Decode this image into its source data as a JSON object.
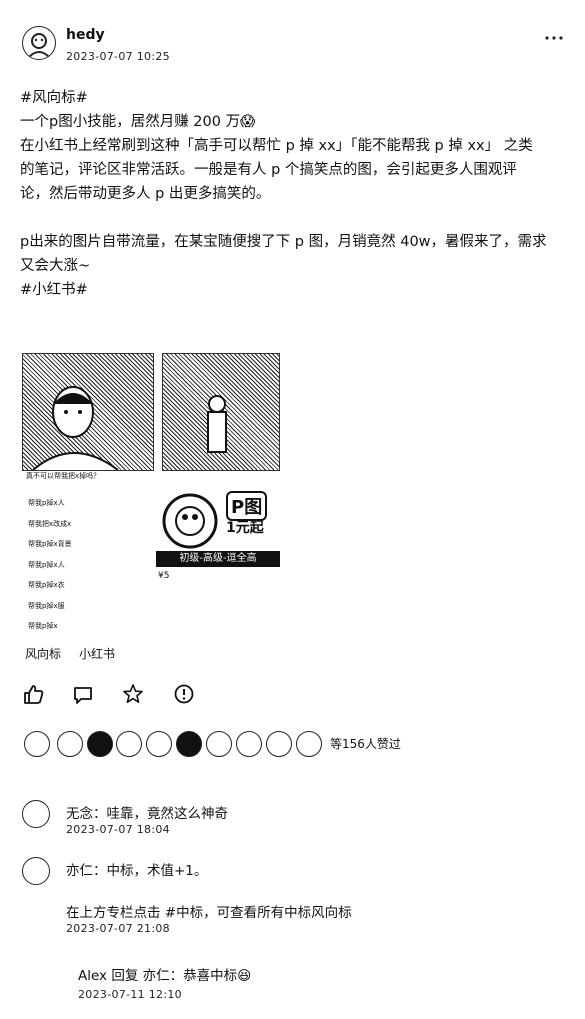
{
  "header": {
    "username": "hedy",
    "timestamp": "2023-07-07 10:25",
    "more_icon": "more-dots-icon"
  },
  "post": {
    "line1": "#风向标#",
    "line2": "一个p图小技能，居然月赚 200 万😱",
    "line3": "在小红书上经常刷到这种「高手可以帮忙 p 掉 xx」「能不能帮我 p 掉 xx」 之类",
    "line4": "的笔记，评论区非常活跃。一般是有人 p 个搞笑点的图，会引起更多人围观评",
    "line5": "论，然后带动更多人 p 出更多搞笑的。",
    "line6": "p出来的图片自带流量，在某宝随便搜了下 p 图，月销竟然 40w，暑假来了，需求",
    "line7": "又会大涨~",
    "line8": "#小红书#"
  },
  "image": {
    "badge_top": "P图",
    "badge_bottom": "1元起",
    "banner": "初级-高级-逗全高",
    "price": "¥5",
    "left_caption": "真不可以帮我把x掉吗？",
    "left_items": [
      "帮我p掉x人",
      "帮我把x改成x",
      "帮我p掉x背景",
      "帮我p掉x人",
      "帮我p掉x衣",
      "帮我p掉x服",
      "帮我p掉x"
    ]
  },
  "tags": [
    "风向标",
    "小红书"
  ],
  "actions": {
    "like": "thumbs-up-icon",
    "comment": "comment-icon",
    "star": "star-icon",
    "report": "alert-icon"
  },
  "likes": {
    "summary": "等156人赞过"
  },
  "comments": [
    {
      "name_text": "无念：哇靠，竟然这么神奇",
      "time": "2023-07-07 18:04"
    },
    {
      "name_text": "亦仁：中标，术值+1。",
      "body2": "在上方专栏点击 #中标，可查看所有中标风向标",
      "time": "2023-07-07 21:08"
    }
  ],
  "reply": {
    "text": "Alex 回复 亦仁：恭喜中标😆",
    "time": "2023-07-11 12:10"
  }
}
